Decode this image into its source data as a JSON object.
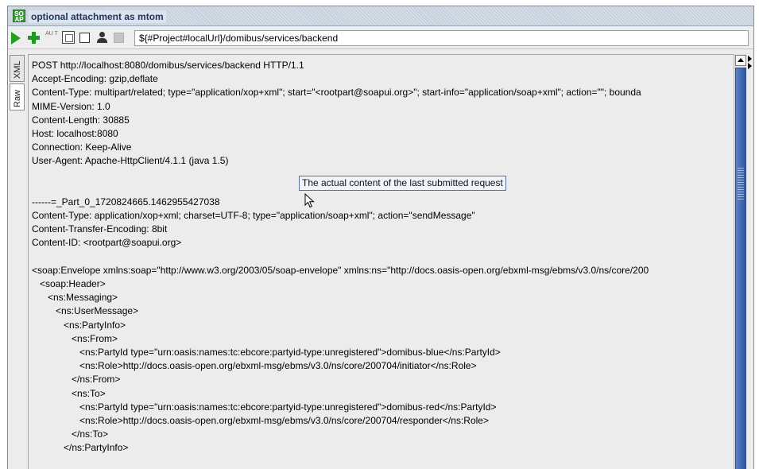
{
  "window": {
    "title": "optional attachment as mtom",
    "title_icon_text": "SO AP"
  },
  "toolbar": {
    "submit_icon": "play-icon",
    "add_icon": "plus-icon",
    "aut_icon_text": "AU T",
    "endpoint": "${#Project#localUrl}/domibus/services/backend"
  },
  "tabs": {
    "xml": "XML",
    "raw": "Raw"
  },
  "raw_request": {
    "lines": [
      "POST http://localhost:8080/domibus/services/backend HTTP/1.1",
      "Accept-Encoding: gzip,deflate",
      "Content-Type: multipart/related; type=\"application/xop+xml\"; start=\"<rootpart@soapui.org>\"; start-info=\"application/soap+xml\"; action=\"\"; bounda",
      "MIME-Version: 1.0",
      "Content-Length: 30885",
      "Host: localhost:8080",
      "Connection: Keep-Alive",
      "User-Agent: Apache-HttpClient/4.1.1 (java 1.5)",
      "",
      "",
      "------=_Part_0_1720824665.1462955427038",
      "Content-Type: application/xop+xml; charset=UTF-8; type=\"application/soap+xml\"; action=\"sendMessage\"",
      "Content-Transfer-Encoding: 8bit",
      "Content-ID: <rootpart@soapui.org>",
      "",
      "<soap:Envelope xmlns:soap=\"http://www.w3.org/2003/05/soap-envelope\" xmlns:ns=\"http://docs.oasis-open.org/ebxml-msg/ebms/v3.0/ns/core/200",
      "   <soap:Header>",
      "      <ns:Messaging>",
      "         <ns:UserMessage>",
      "            <ns:PartyInfo>",
      "               <ns:From>",
      "                  <ns:PartyId type=\"urn:oasis:names:tc:ebcore:partyid-type:unregistered\">domibus-blue</ns:PartyId>",
      "                  <ns:Role>http://docs.oasis-open.org/ebxml-msg/ebms/v3.0/ns/core/200704/initiator</ns:Role>",
      "               </ns:From>",
      "               <ns:To>",
      "                  <ns:PartyId type=\"urn:oasis:names:tc:ebcore:partyid-type:unregistered\">domibus-red</ns:PartyId>",
      "                  <ns:Role>http://docs.oasis-open.org/ebxml-msg/ebms/v3.0/ns/core/200704/responder</ns:Role>",
      "               </ns:To>",
      "            </ns:PartyInfo>"
    ]
  },
  "tooltip": {
    "text": "The actual content of the last submitted request"
  }
}
